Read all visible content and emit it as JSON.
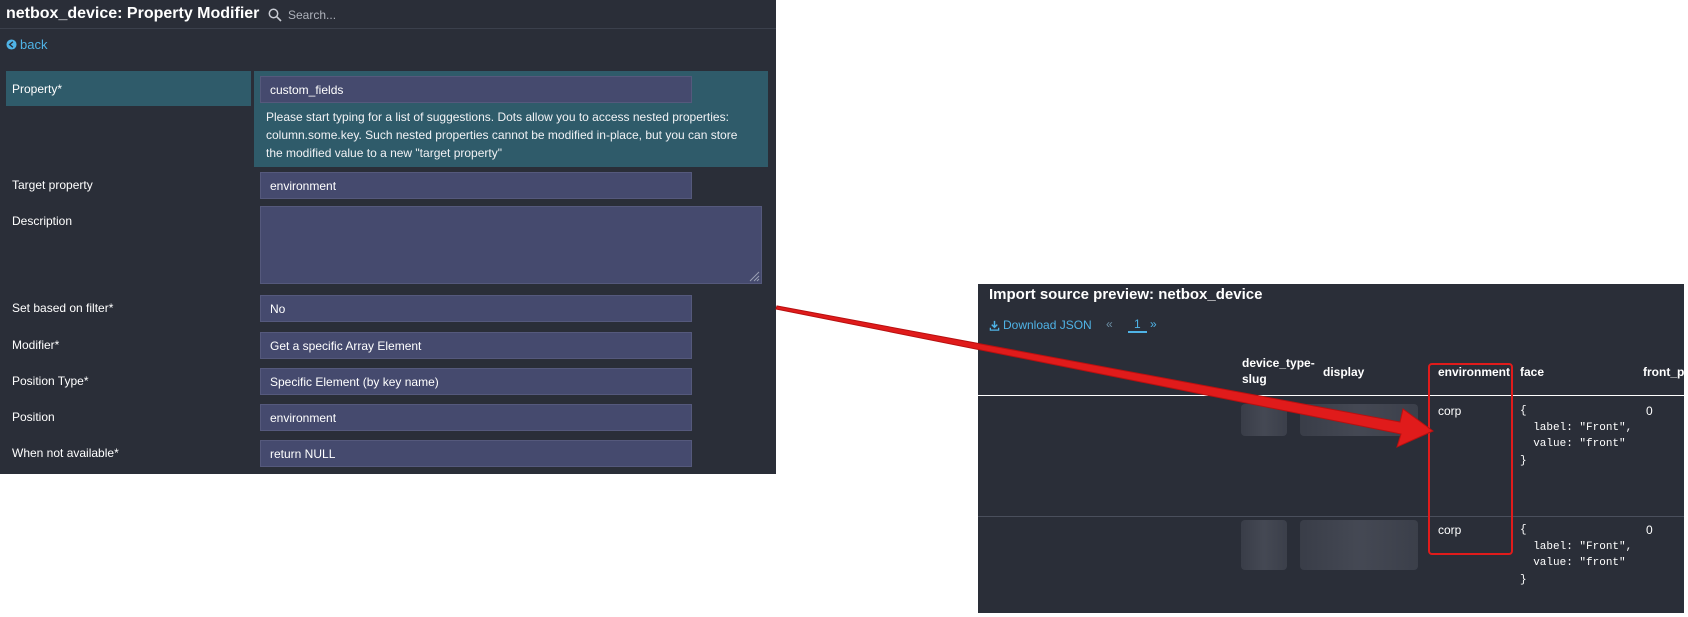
{
  "header": {
    "title": "netbox_device: Property Modifier",
    "search_placeholder": "Search..."
  },
  "back_label": "back",
  "form": {
    "property": {
      "label": "Property*",
      "value": "custom_fields",
      "hint": "Please start typing for a list of suggestions. Dots allow you to access nested properties: column.some.key. Such nested properties cannot be modified in-place, but you can store the modified value to a new \"target property\""
    },
    "target_property": {
      "label": "Target property",
      "value": "environment"
    },
    "description": {
      "label": "Description",
      "value": ""
    },
    "set_based_on_filter": {
      "label": "Set based on filter*",
      "value": "No"
    },
    "modifier": {
      "label": "Modifier*",
      "value": "Get a specific Array Element"
    },
    "position_type": {
      "label": "Position Type*",
      "value": "Specific Element (by key name)"
    },
    "position": {
      "label": "Position",
      "value": "environment"
    },
    "when_not_available": {
      "label": "When not available*",
      "value": "return NULL"
    }
  },
  "preview": {
    "title": "Import source preview: netbox_device",
    "download_label": "Download JSON",
    "pager": {
      "prev": "«",
      "page": "1",
      "next": "»"
    },
    "columns": [
      "device_type-slug",
      "display",
      "environment",
      "face",
      "front_p"
    ],
    "rows": [
      {
        "environment": "corp",
        "face": "{\n  label: \"Front\",\n  value: \"front\"\n}",
        "front_p": "0"
      },
      {
        "environment": "corp",
        "face": "{\n  label: \"Front\",\n  value: \"front\"\n}",
        "front_p": "0"
      }
    ]
  },
  "colors": {
    "panel_bg": "#2a2e38",
    "field_bg": "#454a6e",
    "highlight_bg": "#2f5b6a",
    "link": "#4fb3e6",
    "annotation_red": "#e01b1b"
  }
}
